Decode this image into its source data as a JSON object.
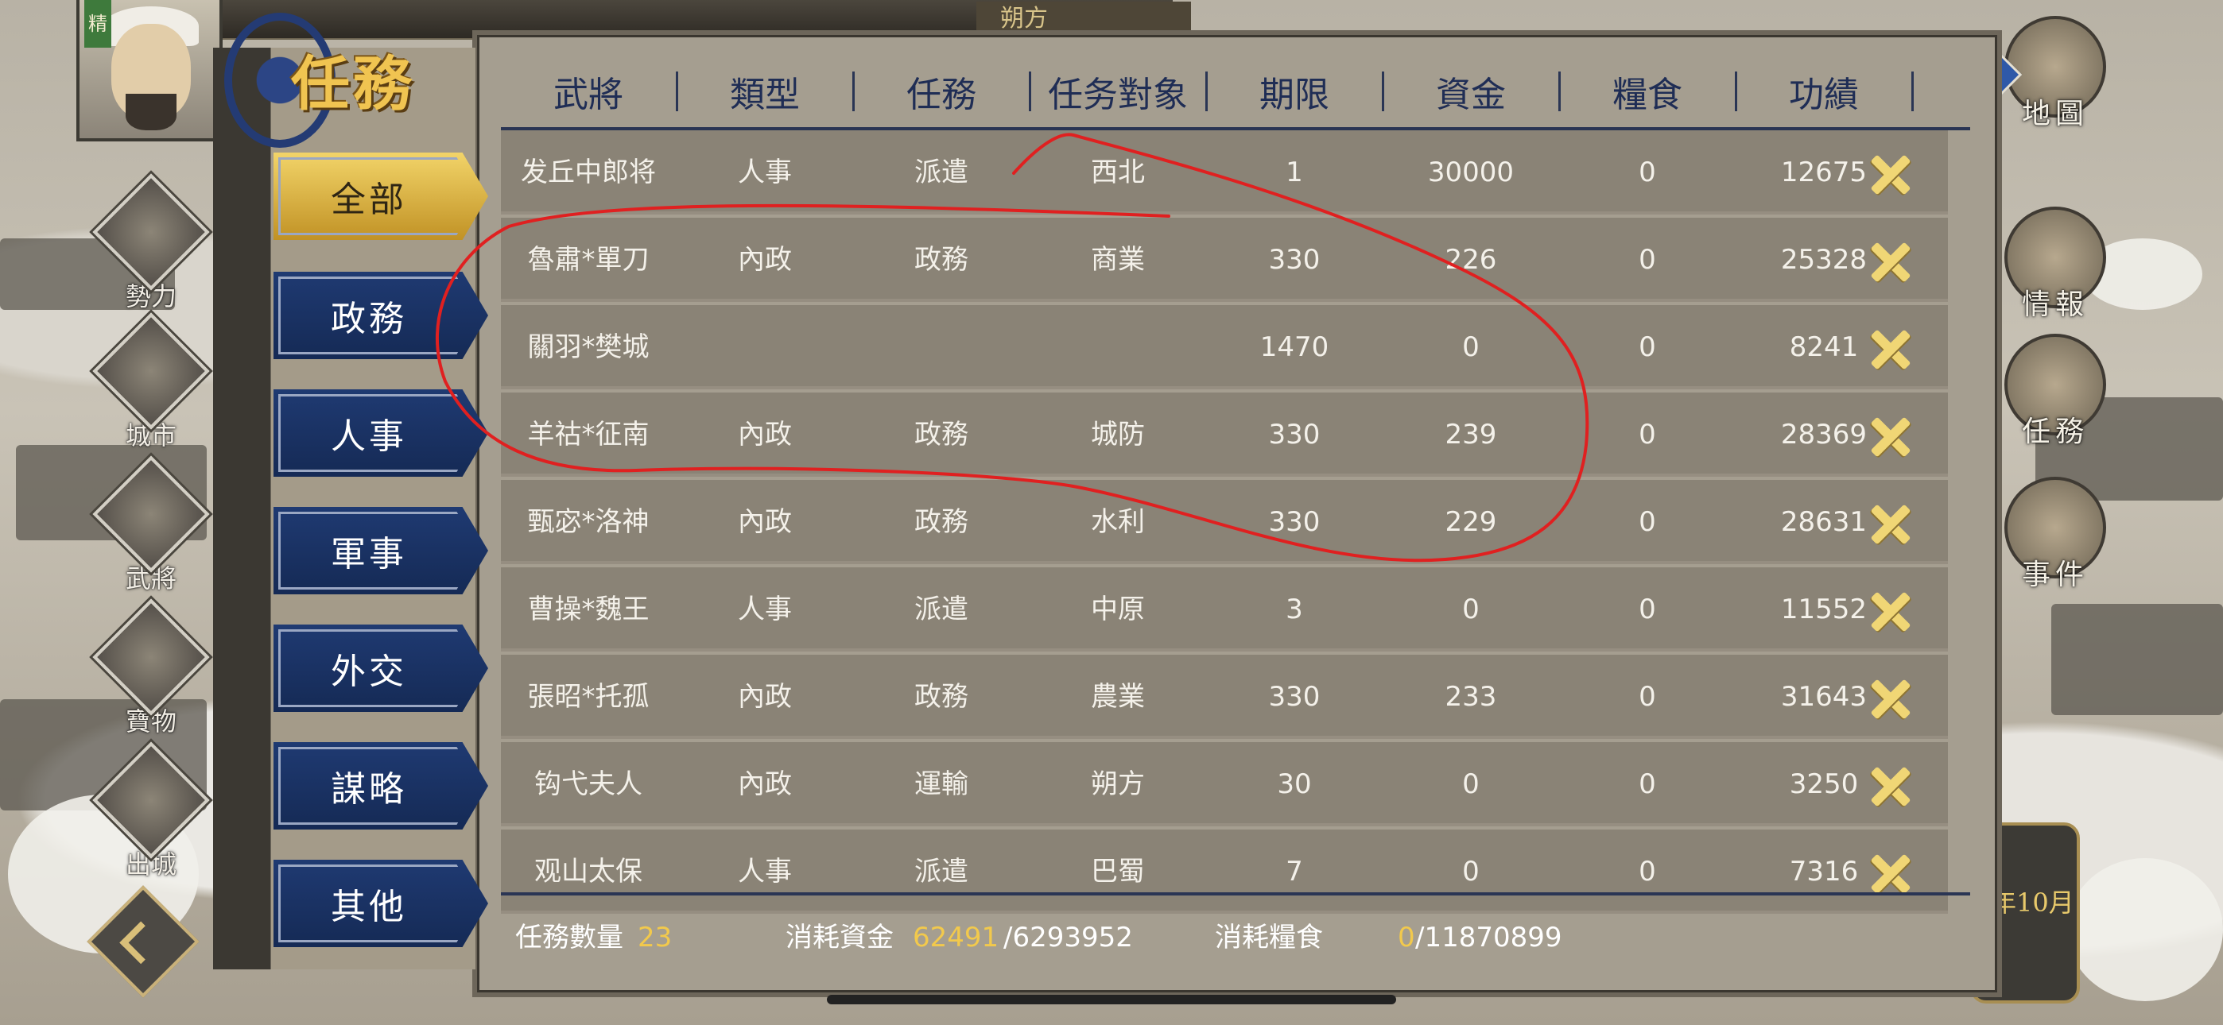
{
  "window": {
    "top_location": "朔方"
  },
  "portrait": {
    "tag": "精"
  },
  "left_nav": [
    {
      "label": "勢力",
      "icon": "faction-icon"
    },
    {
      "label": "城市",
      "icon": "city-icon"
    },
    {
      "label": "武將",
      "icon": "general-icon"
    },
    {
      "label": "寶物",
      "icon": "treasure-icon"
    },
    {
      "label": "出城",
      "icon": "exit-city-icon"
    }
  ],
  "right_nav": [
    {
      "label": "地圖",
      "icon": "map-icon"
    },
    {
      "label": "情報",
      "icon": "intel-icon"
    },
    {
      "label": "任務",
      "icon": "task-icon"
    },
    {
      "label": "事件",
      "icon": "event-icon"
    }
  ],
  "calendar": {
    "text": "年10月"
  },
  "panel": {
    "title": "任務"
  },
  "categories": [
    {
      "label": "全部",
      "active": true
    },
    {
      "label": "政務",
      "active": false
    },
    {
      "label": "人事",
      "active": false
    },
    {
      "label": "軍事",
      "active": false
    },
    {
      "label": "外交",
      "active": false
    },
    {
      "label": "謀略",
      "active": false
    },
    {
      "label": "其他",
      "active": false
    }
  ],
  "table": {
    "headers": [
      "武將",
      "類型",
      "任務",
      "任务對象",
      "期限",
      "資金",
      "糧食",
      "功績"
    ],
    "rows": [
      {
        "general": "发丘中郎将",
        "type": "人事",
        "task": "派遣",
        "target": "西北",
        "term": "1",
        "funds": "30000",
        "food": "0",
        "merit": "12675"
      },
      {
        "general": "魯肅*單刀",
        "type": "內政",
        "task": "政務",
        "target": "商業",
        "term": "330",
        "funds": "226",
        "food": "0",
        "merit": "25328"
      },
      {
        "general": "關羽*樊城",
        "type": "",
        "task": "",
        "target": "",
        "term": "1470",
        "funds": "0",
        "food": "0",
        "merit": "8241"
      },
      {
        "general": "羊祜*征南",
        "type": "內政",
        "task": "政務",
        "target": "城防",
        "term": "330",
        "funds": "239",
        "food": "0",
        "merit": "28369"
      },
      {
        "general": "甄宓*洛神",
        "type": "內政",
        "task": "政務",
        "target": "水利",
        "term": "330",
        "funds": "229",
        "food": "0",
        "merit": "28631"
      },
      {
        "general": "曹操*魏王",
        "type": "人事",
        "task": "派遣",
        "target": "中原",
        "term": "3",
        "funds": "0",
        "food": "0",
        "merit": "11552"
      },
      {
        "general": "張昭*托孤",
        "type": "內政",
        "task": "政務",
        "target": "農業",
        "term": "330",
        "funds": "233",
        "food": "0",
        "merit": "31643"
      },
      {
        "general": "钩弋夫人",
        "type": "內政",
        "task": "運輸",
        "target": "朔方",
        "term": "30",
        "funds": "0",
        "food": "0",
        "merit": "3250"
      },
      {
        "general": "观山太保",
        "type": "人事",
        "task": "派遣",
        "target": "巴蜀",
        "term": "7",
        "funds": "0",
        "food": "0",
        "merit": "7316"
      }
    ]
  },
  "footer": {
    "task_count_label": "任務數量",
    "task_count": "23",
    "funds_label": "消耗資金",
    "funds_used": "62491",
    "funds_total": "/6293952",
    "food_label": "消耗糧食",
    "food_used": "0",
    "food_total": "/11870899"
  },
  "colors": {
    "accent_gold": "#f2c94c",
    "tab_blue": "#1f3a72",
    "annotation_red": "#e02020"
  }
}
